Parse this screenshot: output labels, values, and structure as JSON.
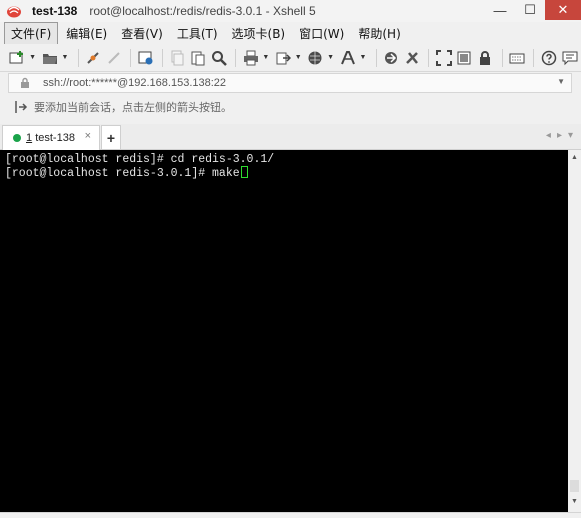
{
  "titlebar": {
    "session_name": "test-138",
    "path_title": "root@localhost:/redis/redis-3.0.1 - Xshell 5",
    "minimize": "—",
    "maximize": "☐",
    "close": "✕"
  },
  "menu": [
    {
      "label": "文件(F)"
    },
    {
      "label": "编辑(E)"
    },
    {
      "label": "查看(V)"
    },
    {
      "label": "工具(T)"
    },
    {
      "label": "选项卡(B)"
    },
    {
      "label": "窗口(W)"
    },
    {
      "label": "帮助(H)"
    }
  ],
  "address": {
    "value": "ssh://root:******@192.168.153.138:22"
  },
  "hint": {
    "text": "要添加当前会话，点击左侧的箭头按钮。"
  },
  "tabs": {
    "active": {
      "index": "1",
      "label": "test-138",
      "close": "×"
    },
    "add": "+",
    "prev": "◂",
    "next": "▸",
    "menu": "▾"
  },
  "terminal": {
    "lines": [
      "[root@localhost redis]# cd redis-3.0.1/",
      "[root@localhost redis-3.0.1]# make"
    ]
  },
  "colors": {
    "close_button": "#c7463c",
    "session_dot": "#1aa34a",
    "cursor": "#2fdc2f",
    "terminal_bg": "#000000"
  }
}
